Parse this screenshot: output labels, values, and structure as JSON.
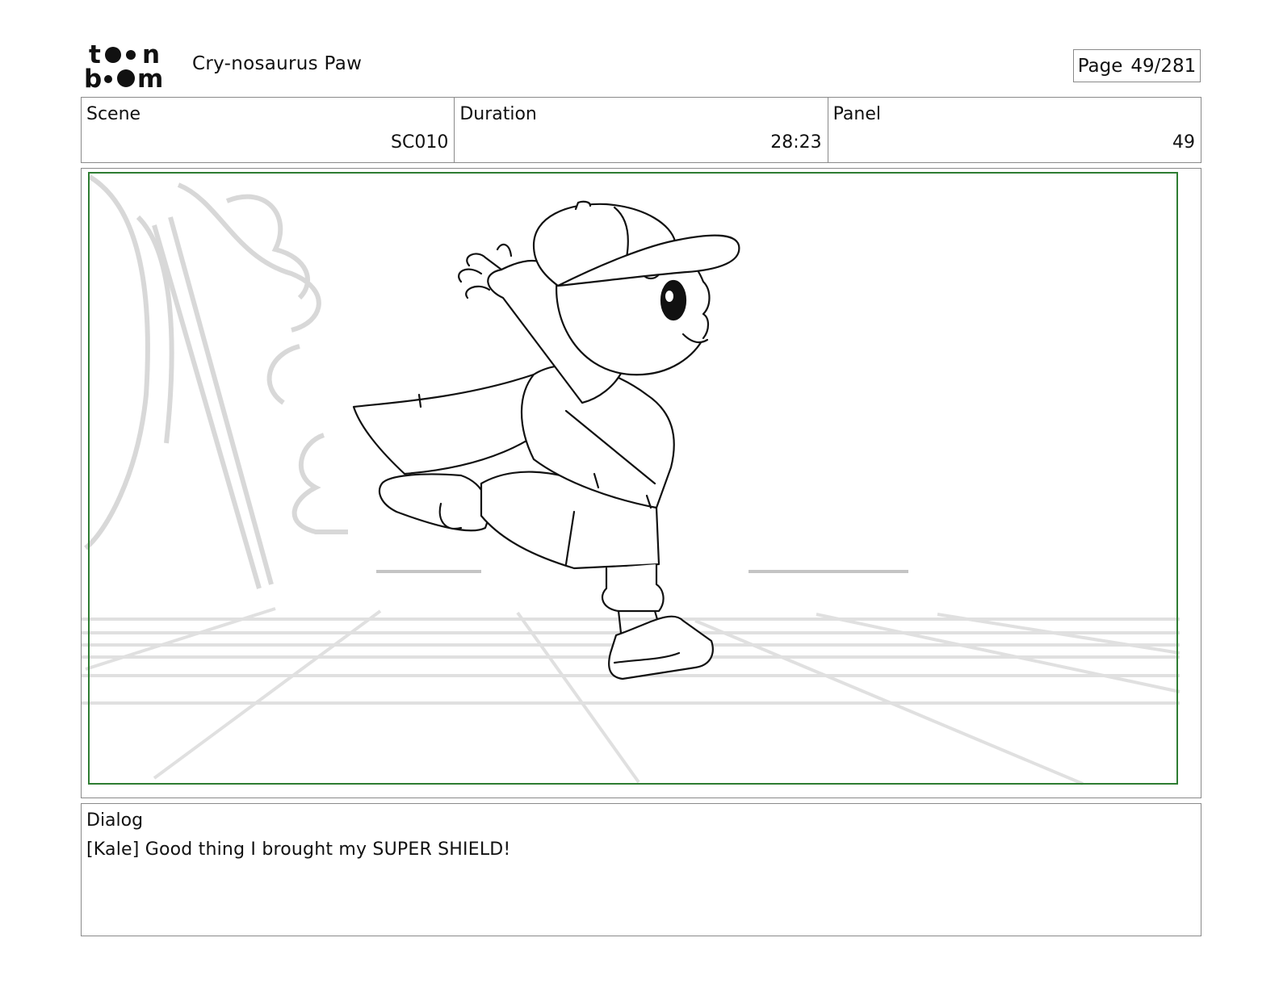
{
  "header": {
    "logo": {
      "line1": "toon",
      "line2": "boom",
      "icon": "toon-boom-logo-icon"
    },
    "project_title": "Cry-nosaurus Paw",
    "page_label": "Page",
    "page_value": "49/281"
  },
  "info": {
    "scene_label": "Scene",
    "scene_value": "SC010",
    "duration_label": "Duration",
    "duration_value": "28:23",
    "panel_label": "Panel",
    "panel_value": "49"
  },
  "panel": {
    "safe_frame_color": "#2e7d32",
    "image": "storyboard-sketch-boy-in-cape-running"
  },
  "dialog": {
    "label": "Dialog",
    "text": "[Kale] Good thing I brought my SUPER SHIELD!"
  }
}
